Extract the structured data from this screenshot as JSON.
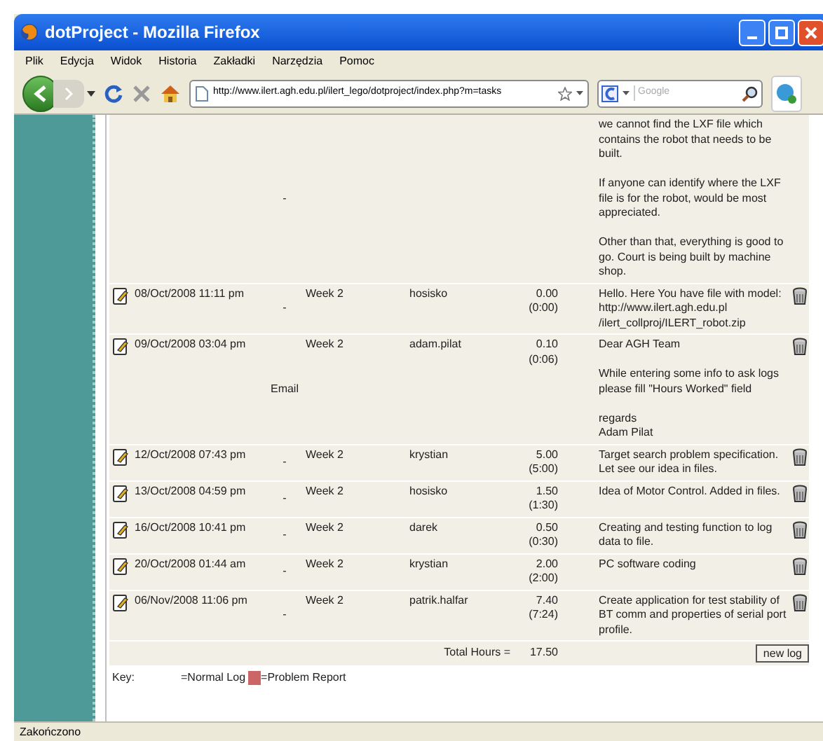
{
  "window": {
    "title": "dotProject - Mozilla Firefox"
  },
  "menu": [
    "Plik",
    "Edycja",
    "Widok",
    "Historia",
    "Zakładki",
    "Narzędzia",
    "Pomoc"
  ],
  "address_bar": {
    "url": "http://www.ilert.agh.edu.pl/ilert_lego/dotproject/index.php?m=tasks"
  },
  "search": {
    "placeholder": "Google"
  },
  "log": {
    "rows": [
      {
        "date": "",
        "type": "-",
        "week": "",
        "user": "",
        "hours": "",
        "duration": "",
        "description": "we cannot find the LXF file which contains the robot that needs to be built.\n\nIf anyone can identify where the LXF file is for the robot, would be most appreciated.\n\nOther than that, everything is good to go. Court is being built by machine shop.",
        "actions": false
      },
      {
        "date": "08/Oct/2008 11:11 pm",
        "type": "-",
        "week": "Week 2",
        "user": "hosisko",
        "hours": "0.00",
        "duration": "(0:00)",
        "description": "Hello. Here You have file with model:\nhttp://www.ilert.agh.edu.pl\n/ilert_collproj/ILERT_robot.zip",
        "actions": true
      },
      {
        "date": "09/Oct/2008 03:04 pm",
        "type": "Email",
        "week": "Week 2",
        "user": "adam.pilat",
        "hours": "0.10",
        "duration": "(0:06)",
        "description": "Dear AGH Team\n\nWhile entering some info to ask logs please fill \"Hours Worked\" field\n\nregards\nAdam Pilat",
        "actions": true
      },
      {
        "date": "12/Oct/2008 07:43 pm",
        "type": "-",
        "week": "Week 2",
        "user": "krystian",
        "hours": "5.00",
        "duration": "(5:00)",
        "description": "Target search problem specification. Let see our idea in files.",
        "actions": true
      },
      {
        "date": "13/Oct/2008 04:59 pm",
        "type": "-",
        "week": "Week 2",
        "user": "hosisko",
        "hours": "1.50",
        "duration": "(1:30)",
        "description": "Idea of Motor Control. Added in files.",
        "actions": true
      },
      {
        "date": "16/Oct/2008 10:41 pm",
        "type": "-",
        "week": "Week 2",
        "user": "darek",
        "hours": "0.50",
        "duration": "(0:30)",
        "description": "Creating and testing function to log data to file.",
        "actions": true
      },
      {
        "date": "20/Oct/2008 01:44 am",
        "type": "-",
        "week": "Week 2",
        "user": "krystian",
        "hours": "2.00",
        "duration": "(2:00)",
        "description": "PC software coding",
        "actions": true
      },
      {
        "date": "06/Nov/2008 11:06 pm",
        "type": "-",
        "week": "Week 2",
        "user": "patrik.halfar",
        "hours": "7.40",
        "duration": "(7:24)",
        "description": "Create application for test stability of BT comm and properties of serial port profile.",
        "actions": true
      }
    ],
    "total_label": "Total Hours =",
    "total_value": "17.50",
    "new_button": "new log"
  },
  "key": {
    "label": "Key:",
    "items": [
      {
        "label": "=Normal Log"
      },
      {
        "label": "=Problem Report",
        "color": "#cc6666"
      }
    ]
  },
  "status_bar": {
    "text": "Zakończono"
  }
}
